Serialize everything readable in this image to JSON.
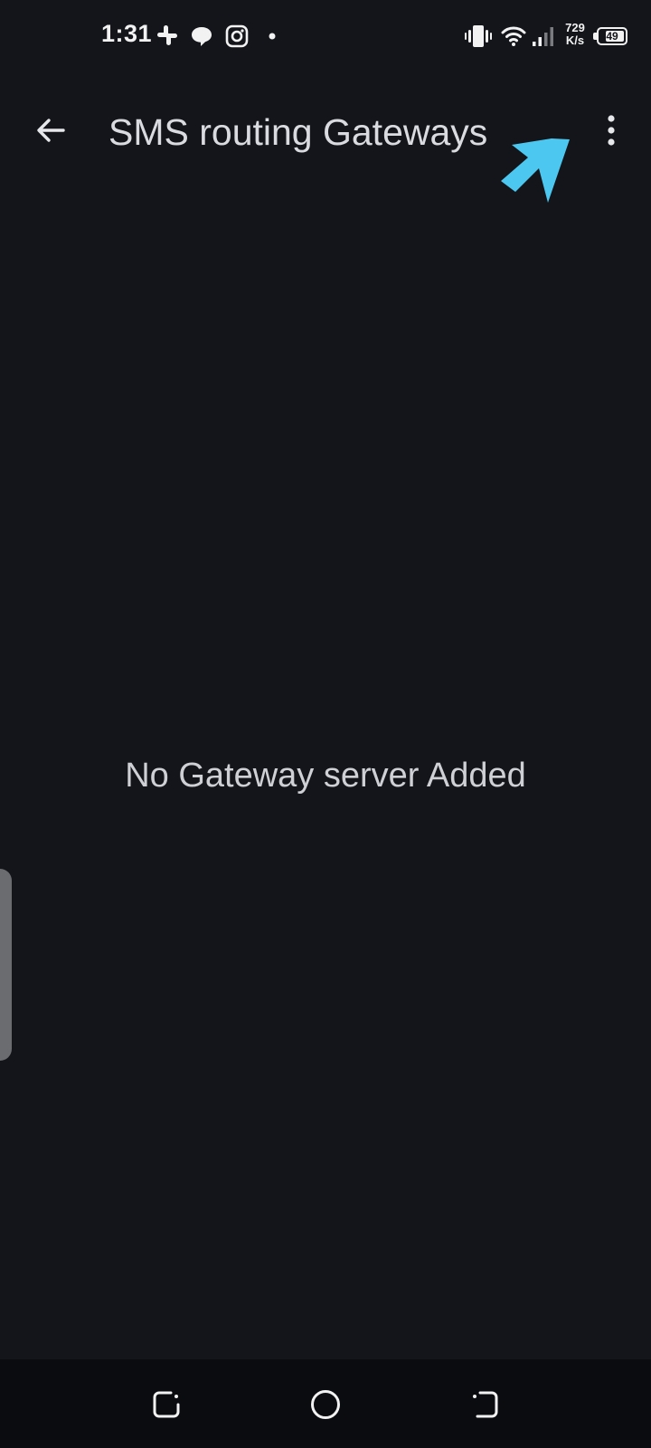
{
  "status_bar": {
    "time": "1:31",
    "icons": [
      "slack-icon",
      "chat-bubble-icon",
      "instagram-icon",
      "notification-dot-icon",
      "vibrate-icon",
      "wifi-icon",
      "signal-icon",
      "battery-icon"
    ],
    "net_speed_value": "729",
    "net_speed_unit": "K/s",
    "battery_level": "49"
  },
  "app_bar": {
    "title": "SMS routing Gateways",
    "back_icon": "arrow-back-icon",
    "overflow_icon": "more-vert-icon"
  },
  "annotation": {
    "pointer_color": "#4cc8f0"
  },
  "main": {
    "empty_message": "No Gateway server Added"
  },
  "nav_bar": {
    "buttons": [
      "recent-apps-icon",
      "home-icon",
      "back-nav-icon"
    ]
  },
  "colors": {
    "background": "#14151a",
    "nav_background": "#0b0c10",
    "text": "#dadbe0",
    "accent_pointer": "#4cc8f0"
  }
}
